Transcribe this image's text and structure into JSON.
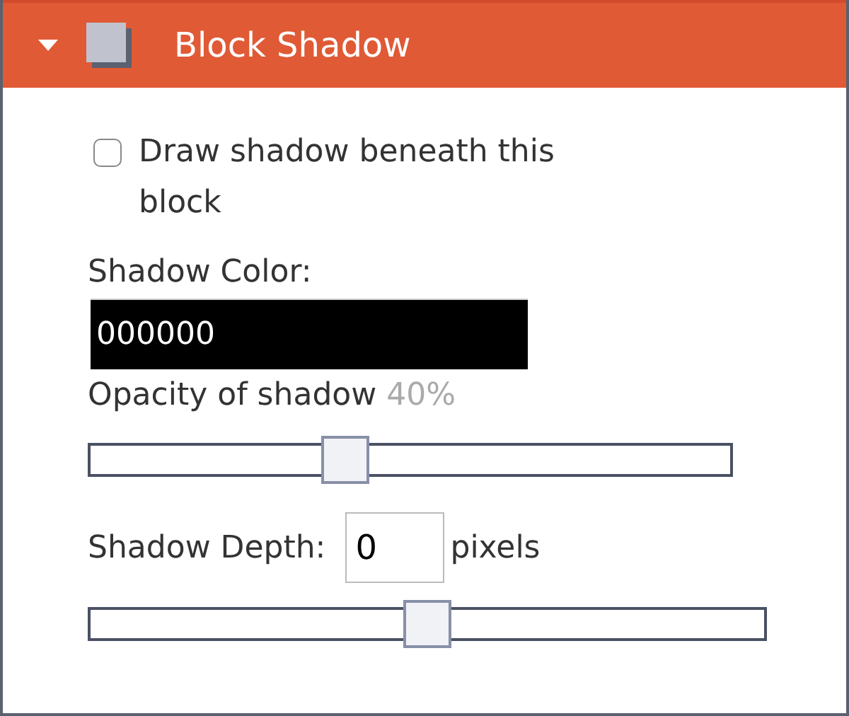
{
  "panel": {
    "title": "Block Shadow",
    "expanded": true
  },
  "shadow_checkbox": {
    "label": "Draw shadow beneath this block",
    "checked": false
  },
  "shadow_color": {
    "label": "Shadow Color:",
    "value": "000000"
  },
  "opacity": {
    "label": "Opacity of shadow",
    "reading": "40%",
    "level": 0.4
  },
  "depth": {
    "label": "Shadow Depth:",
    "value": "0",
    "unit": "pixels",
    "level": 0.5
  }
}
